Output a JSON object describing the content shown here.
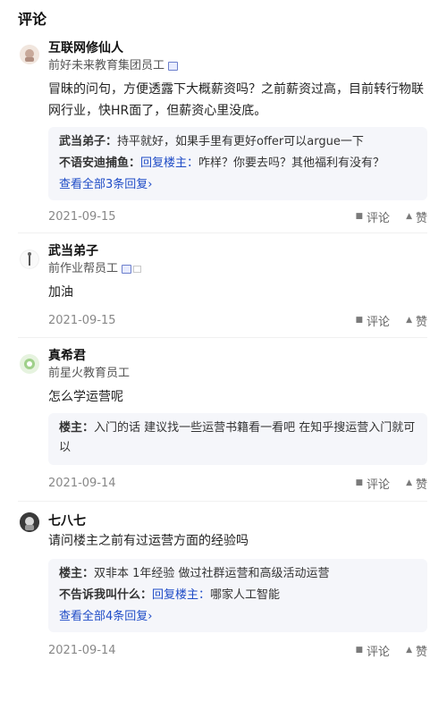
{
  "section_title": "评论",
  "actions": {
    "comment_label": "评论",
    "like_label": "赞"
  },
  "comments": [
    {
      "name": "互联网修仙人",
      "title": "前好未来教育集团员工",
      "content": "冒昧的问句，方便透露下大概薪资吗？之前薪资过高，目前转行物联网行业，快HR面了，但薪资心里没底。",
      "replies": [
        {
          "author": "武当弟子：",
          "text": "持平就好，如果手里有更好offer可以argue一下"
        },
        {
          "author": "不语安迪捕鱼：",
          "reply_to": "回复楼主：",
          "text": "咋样？你要去吗？其他福利有没有？"
        }
      ],
      "see_all": "查看全部3条回复›",
      "date": "2021-09-15"
    },
    {
      "name": "武当弟子",
      "title": "前作业帮员工",
      "content": "加油",
      "date": "2021-09-15"
    },
    {
      "name": "真希君",
      "title": "前星火教育员工",
      "content": "怎么学运营呢",
      "replies": [
        {
          "author": "楼主：",
          "text": "入门的话 建议找一些运营书籍看一看吧 在知乎搜运营入门就可以"
        }
      ],
      "date": "2021-09-14"
    },
    {
      "name": "七八七",
      "content": "请问楼主之前有过运营方面的经验吗",
      "replies": [
        {
          "author": "楼主：",
          "text": "双非本 1年经验 做过社群运营和高级活动运营"
        },
        {
          "author": "不告诉我叫什么：",
          "reply_to": "回复楼主：",
          "text": "哪家人工智能"
        }
      ],
      "see_all": "查看全部4条回复›",
      "date": "2021-09-14"
    }
  ]
}
